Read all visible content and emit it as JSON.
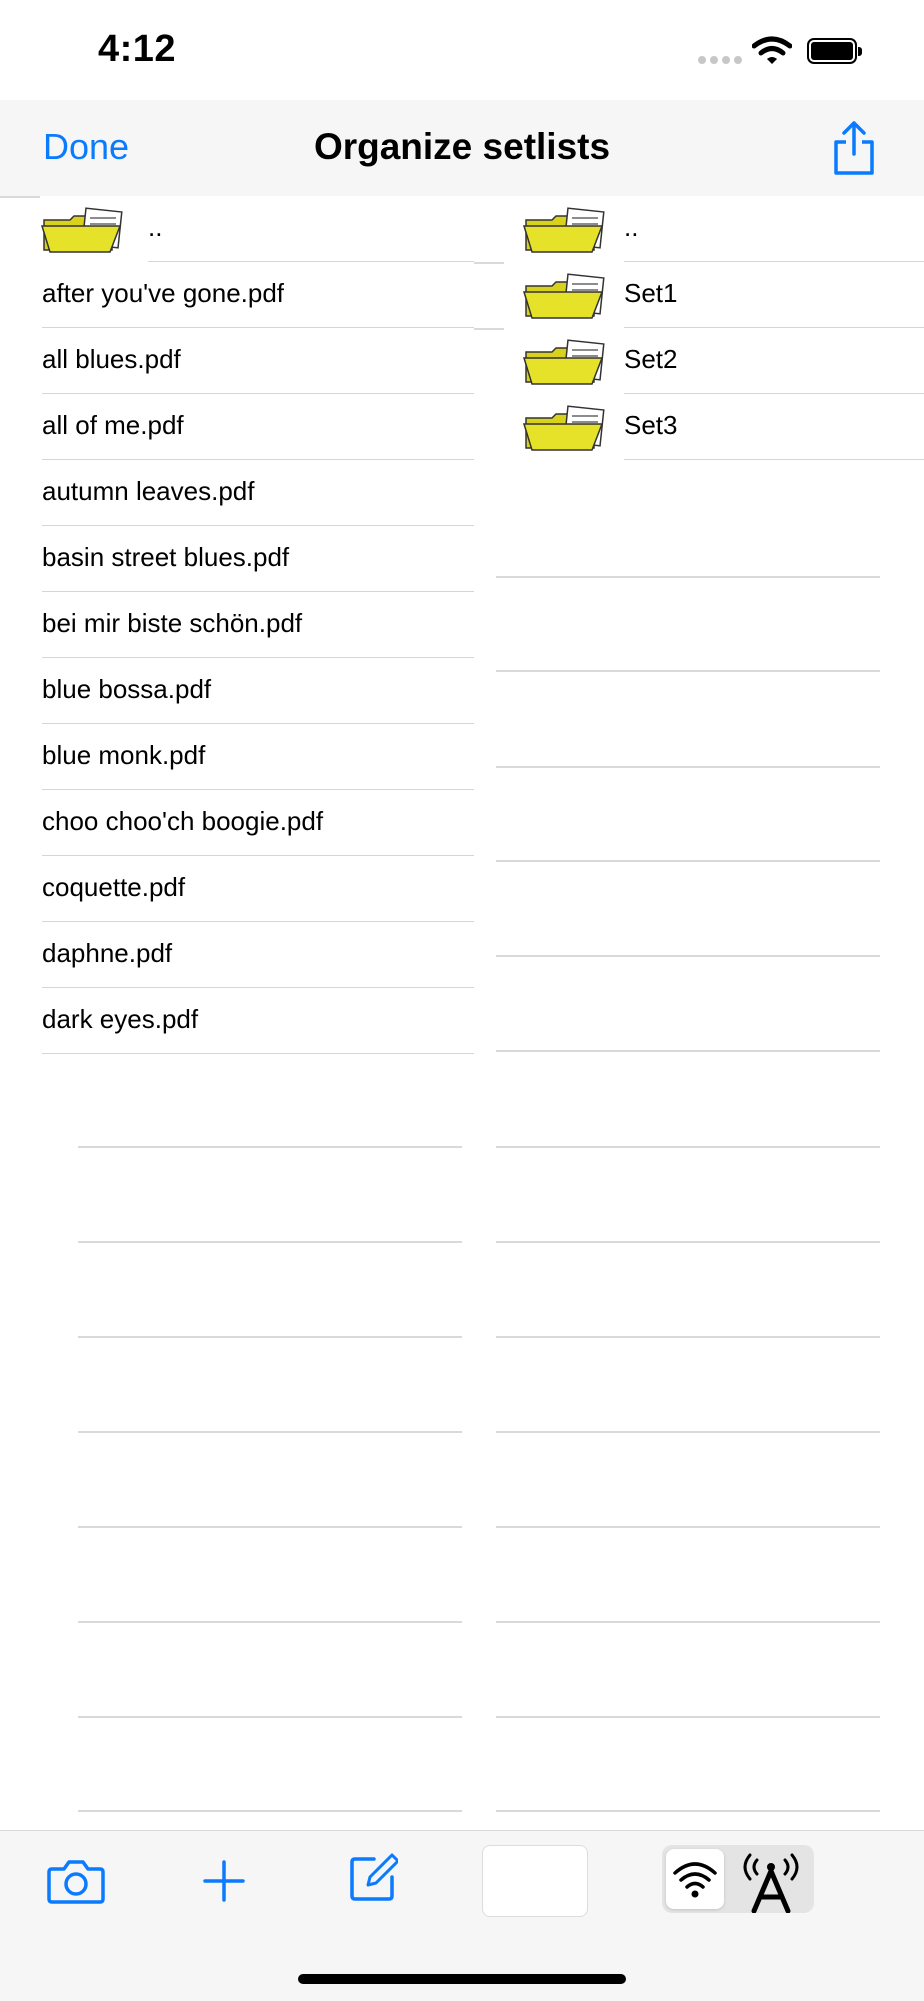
{
  "status_bar": {
    "time": "4:12"
  },
  "nav": {
    "done_label": "Done",
    "title": "Organize setlists",
    "share_icon": "share-icon"
  },
  "left_list": {
    "items": [
      {
        "label": "..",
        "icon": "folder-icon"
      },
      {
        "label": "after you've gone.pdf"
      },
      {
        "label": "all blues.pdf"
      },
      {
        "label": "all of me.pdf"
      },
      {
        "label": "autumn leaves.pdf"
      },
      {
        "label": "basin street blues.pdf"
      },
      {
        "label": "bei mir biste schön.pdf"
      },
      {
        "label": "blue bossa.pdf"
      },
      {
        "label": "blue monk.pdf"
      },
      {
        "label": "choo choo'ch boogie.pdf"
      },
      {
        "label": "coquette.pdf"
      },
      {
        "label": "daphne.pdf"
      },
      {
        "label": "dark eyes.pdf"
      }
    ]
  },
  "right_list": {
    "items": [
      {
        "label": "..",
        "icon": "folder-icon"
      },
      {
        "label": "Set1",
        "icon": "folder-icon"
      },
      {
        "label": "Set2",
        "icon": "folder-icon"
      },
      {
        "label": "Set3",
        "icon": "folder-icon"
      }
    ]
  },
  "toolbar": {
    "camera_icon": "camera-icon",
    "add_icon": "plus-icon",
    "edit_icon": "compose-icon",
    "segment_options": [
      "wifi-icon",
      "broadcast-antenna-icon"
    ],
    "segment_selected": "wifi-icon"
  },
  "colors": {
    "accent": "#0a7aff",
    "folder": "#e6e22a",
    "nav_bg": "#f6f6f6"
  }
}
